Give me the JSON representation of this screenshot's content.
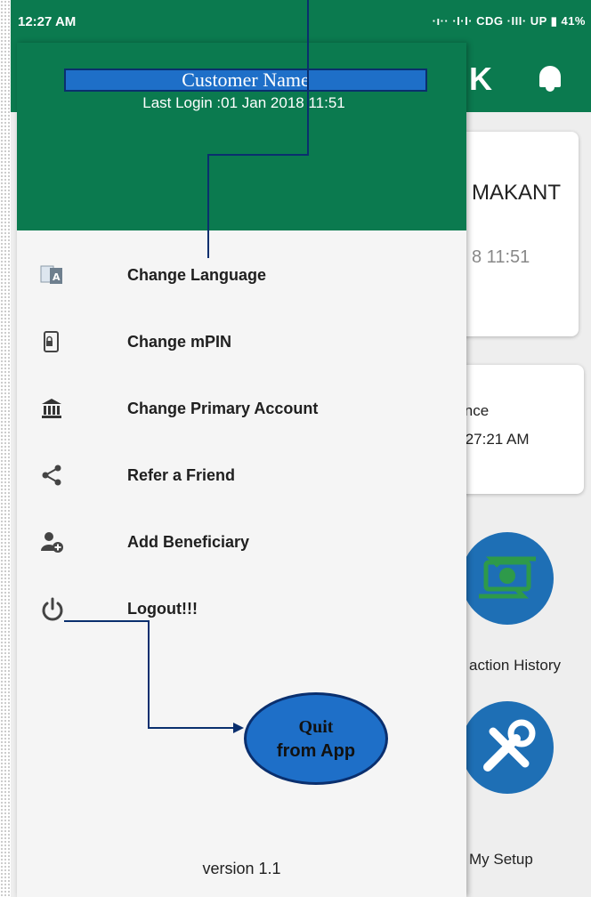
{
  "status_bar": {
    "time": "12:27 AM",
    "indicators": "·ı·· ·I·I· CDG ·III· UP ▮ 41%"
  },
  "drawer": {
    "customer_name": "Customer Name",
    "last_login": "Last Login :01 Jan 2018 11:51",
    "items": [
      {
        "label": "Change Language",
        "icon": "translate-icon"
      },
      {
        "label": "Change mPIN",
        "icon": "phone-lock-icon"
      },
      {
        "label": "Change Primary Account",
        "icon": "bank-icon"
      },
      {
        "label": "Refer a Friend",
        "icon": "share-icon"
      },
      {
        "label": "Add Beneficiary",
        "icon": "add-user-icon"
      },
      {
        "label": "Logout!!!",
        "icon": "power-icon"
      }
    ],
    "version": "version 1.1"
  },
  "background": {
    "name_partial": "MAKANT",
    "time_partial": "8 11:51",
    "since_line1": "ince",
    "since_line2": ":27:21 AM",
    "tile1_label": "action History",
    "tile2_label": "My Setup"
  },
  "annotation": {
    "line1": "Quit",
    "line2": "from App"
  },
  "colors": {
    "header_green": "#0b7a4f",
    "annotation_blue": "#1e6fc8",
    "annotation_line": "#0a2f6e"
  }
}
